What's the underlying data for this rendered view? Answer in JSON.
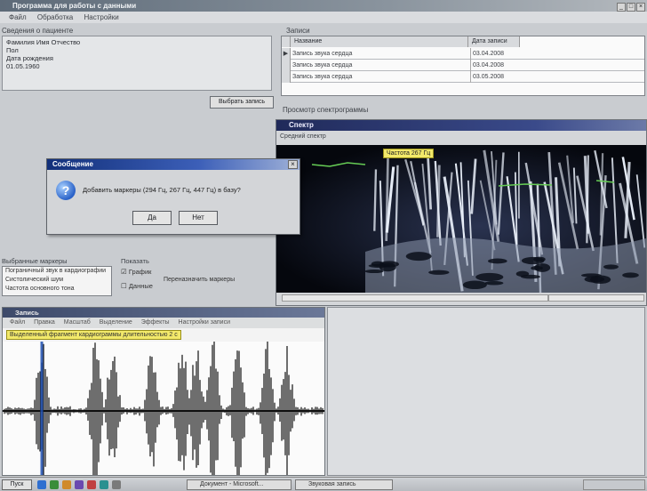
{
  "window": {
    "title": "Программа для работы с данными"
  },
  "menu": [
    "Файл",
    "Обработка",
    "Настройки"
  ],
  "info_panel": {
    "label": "Сведения о пациенте",
    "lines": [
      "Фамилия Имя Отчество",
      "Пол",
      "Дата рождения",
      "01.05.1960"
    ],
    "select_button": "Выбрать запись"
  },
  "records": {
    "label": "Записи",
    "columns": [
      "Название",
      "Дата записи"
    ],
    "rows": [
      {
        "marker": "▶",
        "name": "Запись звука сердца",
        "date": "03.04.2008"
      },
      {
        "marker": "",
        "name": "Запись звука сердца",
        "date": "03.04.2008"
      },
      {
        "marker": "",
        "name": "Запись звука сердца",
        "date": "03.05.2008"
      }
    ],
    "footer": "Просмотр спектрограммы"
  },
  "spectrogram": {
    "title": "Спектр",
    "subtitle": "Средний спектр",
    "tag": "Частота 267 Гц"
  },
  "dialog": {
    "title": "Сообщение",
    "icon": "question-icon",
    "message": "Добавить маркеры (294 Гц, 267 Гц, 447 Гц) в базу?",
    "ok_label": "Да",
    "no_label": "Нет"
  },
  "markers_list": {
    "label": "Выбранные маркеры",
    "items": [
      "Пограничный звук в кардиографии",
      "Систолический шум",
      "Частота основного тона"
    ]
  },
  "display_options": {
    "label": "Показать",
    "option1": "График",
    "option2": "Данные",
    "option1_checked": true,
    "option2_checked": false,
    "reassign_label": "Переназначить маркеры"
  },
  "waveform": {
    "title": "Запись",
    "menu": [
      "Файл",
      "Правка",
      "Масштаб",
      "Выделение",
      "Эффекты",
      "Настройки записи"
    ],
    "tag": "Выделенный фрагмент кардиограммы длительностью 2 с"
  },
  "taskbar": {
    "start": "Пуск",
    "tasks": [
      "Документ - Microsoft...",
      "Звуковая запись"
    ]
  }
}
